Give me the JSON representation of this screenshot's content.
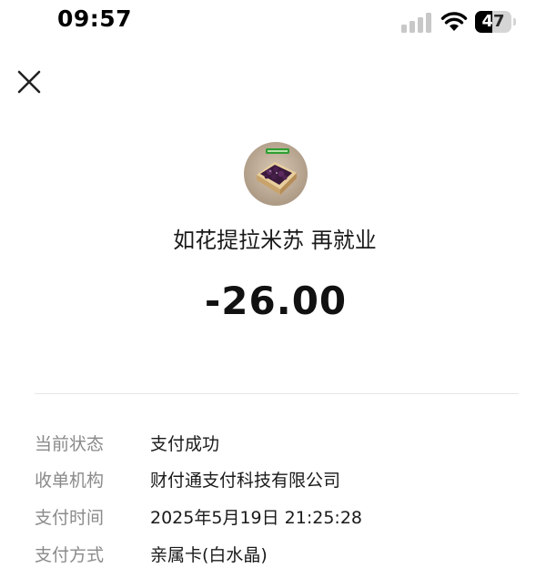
{
  "status_bar": {
    "time": "09:57",
    "battery_level": "47",
    "battery_fraction": 0.47
  },
  "header": {
    "close_icon": "close-icon"
  },
  "merchant": {
    "avatar_icon": "merchant-avatar-image",
    "name": "如花提拉米苏 再就业"
  },
  "amount": "-26.00",
  "details": [
    {
      "label": "当前状态",
      "value": "支付成功"
    },
    {
      "label": "收单机构",
      "value": "财付通支付科技有限公司"
    },
    {
      "label": "支付时间",
      "value": "2025年5月19日 21:25:28"
    },
    {
      "label": "支付方式",
      "value": "亲属卡(白水晶)"
    }
  ],
  "colors": {
    "label_gray": "#8a8a8a",
    "text_dark": "#1a1a1a",
    "divider": "#e6e6e6"
  }
}
